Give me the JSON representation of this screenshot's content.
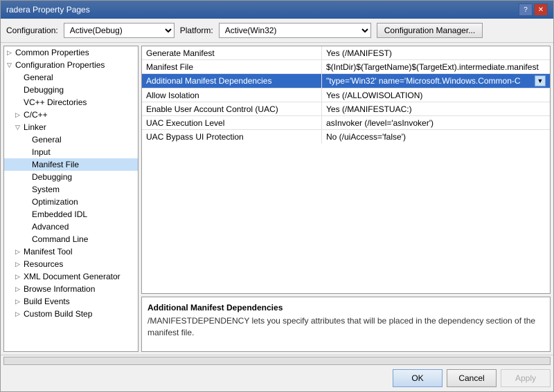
{
  "dialog": {
    "title": "radera Property Pages"
  },
  "toolbar": {
    "configuration_label": "Configuration:",
    "configuration_value": "Active(Debug)",
    "platform_label": "Platform:",
    "platform_value": "Active(Win32)",
    "config_manager_label": "Configuration Manager..."
  },
  "tree": {
    "items": [
      {
        "id": "common-properties",
        "label": "Common Properties",
        "level": 0,
        "expandable": true,
        "expanded": false,
        "arrow": "▷"
      },
      {
        "id": "configuration-properties",
        "label": "Configuration Properties",
        "level": 0,
        "expandable": true,
        "expanded": true,
        "arrow": "▽"
      },
      {
        "id": "general",
        "label": "General",
        "level": 1,
        "expandable": false
      },
      {
        "id": "debugging",
        "label": "Debugging",
        "level": 1,
        "expandable": false
      },
      {
        "id": "vc-directories",
        "label": "VC++ Directories",
        "level": 1,
        "expandable": false
      },
      {
        "id": "c-cpp",
        "label": "C/C++",
        "level": 1,
        "expandable": true,
        "arrow": "▷"
      },
      {
        "id": "linker",
        "label": "Linker",
        "level": 1,
        "expandable": true,
        "expanded": true,
        "arrow": "▽"
      },
      {
        "id": "linker-general",
        "label": "General",
        "level": 2,
        "expandable": false
      },
      {
        "id": "linker-input",
        "label": "Input",
        "level": 2,
        "expandable": false
      },
      {
        "id": "linker-manifest",
        "label": "Manifest File",
        "level": 2,
        "expandable": false,
        "selected": true
      },
      {
        "id": "linker-debugging",
        "label": "Debugging",
        "level": 2,
        "expandable": false
      },
      {
        "id": "linker-system",
        "label": "System",
        "level": 2,
        "expandable": false
      },
      {
        "id": "linker-optimization",
        "label": "Optimization",
        "level": 2,
        "expandable": false
      },
      {
        "id": "linker-embedded-idl",
        "label": "Embedded IDL",
        "level": 2,
        "expandable": false
      },
      {
        "id": "linker-advanced",
        "label": "Advanced",
        "level": 2,
        "expandable": false
      },
      {
        "id": "linker-command-line",
        "label": "Command Line",
        "level": 2,
        "expandable": false
      },
      {
        "id": "manifest-tool",
        "label": "Manifest Tool",
        "level": 1,
        "expandable": true,
        "arrow": "▷"
      },
      {
        "id": "resources",
        "label": "Resources",
        "level": 1,
        "expandable": true,
        "arrow": "▷"
      },
      {
        "id": "xml-document-generator",
        "label": "XML Document Generator",
        "level": 1,
        "expandable": true,
        "arrow": "▷"
      },
      {
        "id": "browse-information",
        "label": "Browse Information",
        "level": 1,
        "expandable": true,
        "arrow": "▷"
      },
      {
        "id": "build-events",
        "label": "Build Events",
        "level": 1,
        "expandable": true,
        "arrow": "▷"
      },
      {
        "id": "custom-build-step",
        "label": "Custom Build Step",
        "level": 1,
        "expandable": true,
        "arrow": "▷"
      }
    ]
  },
  "properties": {
    "rows": [
      {
        "id": "generate-manifest",
        "name": "Generate Manifest",
        "value": "Yes (/MANIFEST)",
        "selected": false
      },
      {
        "id": "manifest-file",
        "name": "Manifest File",
        "value": "$(IntDir)$(TargetName)$(TargetExt).intermediate.manifest",
        "selected": false
      },
      {
        "id": "additional-manifest-deps",
        "name": "Additional Manifest Dependencies",
        "value": "\"type='Win32' name='Microsoft.Windows.Common-C",
        "selected": true,
        "has_dropdown": true
      },
      {
        "id": "allow-isolation",
        "name": "Allow Isolation",
        "value": "Yes (/ALLOWISOLATION)",
        "selected": false
      },
      {
        "id": "enable-uac",
        "name": "Enable User Account Control (UAC)",
        "value": "Yes (/MANIFESTUAC:)",
        "selected": false
      },
      {
        "id": "uac-execution-level",
        "name": "UAC Execution Level",
        "value": "asInvoker (/level='asInvoker')",
        "selected": false
      },
      {
        "id": "uac-bypass-ui",
        "name": "UAC Bypass UI Protection",
        "value": "No (/uiAccess='false')",
        "selected": false
      }
    ]
  },
  "description": {
    "title": "Additional Manifest Dependencies",
    "text": "/MANIFESTDEPENDENCY lets you specify attributes that will be placed in the dependency section of the manifest file."
  },
  "buttons": {
    "ok": "OK",
    "cancel": "Cancel",
    "apply": "Apply"
  },
  "title_btn": {
    "help": "?",
    "close": "✕"
  }
}
